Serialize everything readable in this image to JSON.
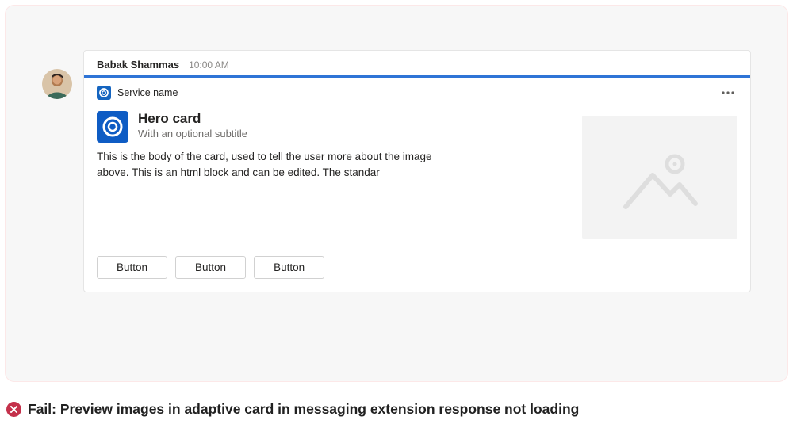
{
  "message": {
    "sender": "Babak Shammas",
    "time": "10:00 AM",
    "service_name": "Service name",
    "card": {
      "title": "Hero card",
      "subtitle": "With an optional subtitle",
      "body": "This is the body of the card, used to tell the user more about the image above. This is an html block and can be edited. The standar",
      "buttons": [
        "Button",
        "Button",
        "Button"
      ]
    }
  },
  "footer": {
    "fail_label": "Fail: Preview images in adaptive card in messaging extension response not loading"
  }
}
